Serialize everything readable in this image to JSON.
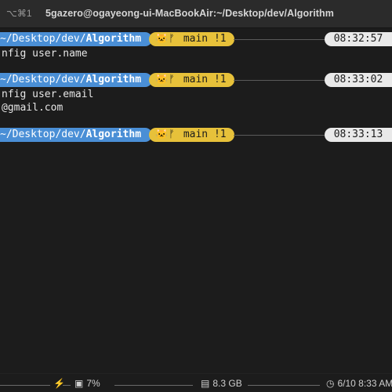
{
  "titlebar": {
    "shortcut": "⌥⌘1",
    "title": "5gazero@ogayeong-ui-MacBookAir:~/Desktop/dev/Algorithm"
  },
  "prompt": {
    "path_prefix": "~/Desktop/dev/",
    "path_dir": "Algorithm",
    "git_branch": "main !1",
    "git_icon": "github-icon",
    "branch_icon": "branch-icon"
  },
  "blocks": [
    {
      "time": "08:32:57",
      "output": [
        "nfig user.name"
      ]
    },
    {
      "time": "08:33:02",
      "output": [
        "nfig user.email",
        "@gmail.com"
      ]
    },
    {
      "time": "08:33:13",
      "output": []
    }
  ],
  "statusbar": {
    "bolt": "⚡",
    "cpu_icon": "cpu-icon",
    "cpu": "7%",
    "mem_icon": "memory-icon",
    "mem": "8.3 GB",
    "clock_icon": "clock-icon",
    "datetime": "6/10 8:33 AM"
  },
  "colors": {
    "path_bg": "#4a8fd6",
    "git_bg": "#e7c13a",
    "time_bg": "#e9e9e9",
    "bg": "#1c1c1c"
  }
}
